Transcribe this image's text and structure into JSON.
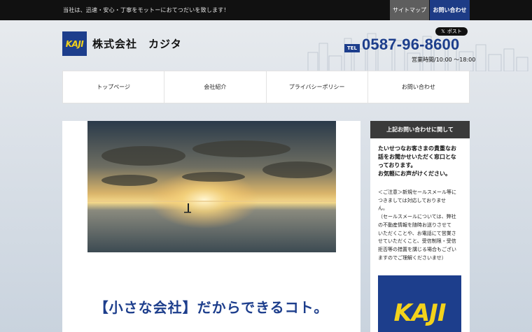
{
  "header": {
    "tagline": "当社は、迅速・安心・丁寧をモットーにおてつだいを致します！",
    "links": [
      {
        "label": "サイトマップ"
      },
      {
        "label": "お問い合わせ"
      }
    ],
    "logo_text": "KAJI",
    "company_name": "株式会社　カジタ",
    "post_button": "ポスト",
    "tel_badge": "TEL",
    "tel": "0587-96-8600",
    "hours": "営業時間/10:00 ～18:00"
  },
  "nav": {
    "items": [
      {
        "label": "トップページ"
      },
      {
        "label": "会社紹介"
      },
      {
        "label": "プライバシーポリシー"
      },
      {
        "label": "お問い合わせ"
      }
    ]
  },
  "main": {
    "headline": "【小さな会社】だからできるコト。"
  },
  "sidebar": {
    "title": "上記お問い合わせに関して",
    "strong_lines": [
      "たいせつなお客さまの貴重なお",
      "話をお聞かせいただく窓口とな",
      "っております。",
      "お気軽にお声がけください。"
    ],
    "note_lines": [
      "＜ご注意＞新規セールスメール等に",
      "つきましては対応しておりませ",
      "ん。",
      "（セールスメールについては、弊社",
      "の不動産情報を随時お送りさせて",
      "いただくことや、お電話にて営業さ",
      "せていただくこと、受信制限・受信",
      "拒否等の措置を講じる場合もござい",
      "ますのでご理解くださいませ）"
    ],
    "logo_text": "KAJI"
  },
  "colors": {
    "brand_blue": "#1d3e8c",
    "logo_yellow": "#f3d21b",
    "topbar": "#111111",
    "sidebar_title": "#3a3a3a"
  }
}
